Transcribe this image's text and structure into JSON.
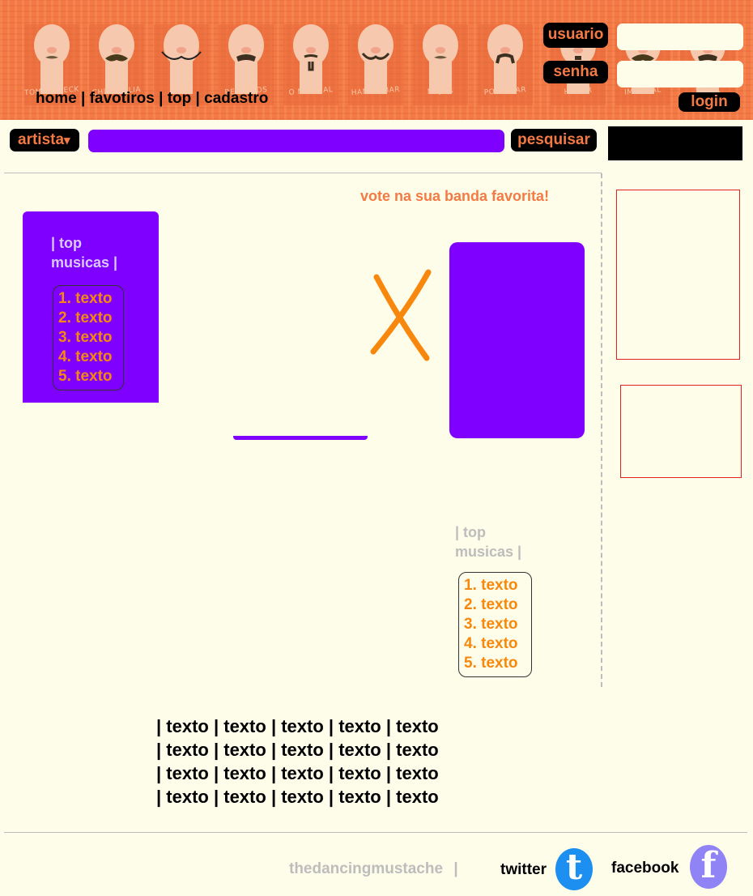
{
  "header": {
    "faces": [
      {
        "label": "TOM SELLECK",
        "mustache": "small"
      },
      {
        "label": "CHINCAGLIA",
        "mustache": "bushy"
      },
      {
        "label": "DALI",
        "mustache": "curled"
      },
      {
        "label": "REYNOLDS",
        "mustache": "walrus"
      },
      {
        "label": "O MICHEAL",
        "mustache": "goatee"
      },
      {
        "label": "HANDLEBAR",
        "mustache": "handlebar"
      },
      {
        "label": "MAJOR",
        "mustache": "small"
      },
      {
        "label": "PORNSTAR",
        "mustache": "horseshoe"
      },
      {
        "label": "HITLER",
        "mustache": "toothbrush"
      },
      {
        "label": "IMPERIAL",
        "mustache": "bushy"
      },
      {
        "label": "ZAPPA",
        "mustache": "walrus"
      }
    ],
    "nav": {
      "home": "home",
      "separator": "|",
      "favoritos": "favotiros",
      "top": "top",
      "cadastro": "cadastro"
    },
    "login": {
      "usuario_label": "usuario",
      "senha_label": "senha",
      "login_button": "login"
    }
  },
  "search": {
    "category_label": "artista",
    "category_arrow": "▾",
    "button_label": "pesquisar"
  },
  "main": {
    "vote_heading": "vote na sua banda favorita!",
    "versus_symbol": "X",
    "top_left": {
      "title_line1": "| top",
      "title_line2": "musicas |",
      "items": [
        "1. texto",
        "2. texto",
        "3. texto",
        "4. texto",
        "5. texto"
      ]
    },
    "top_right": {
      "title_line1": "| top",
      "title_line2": "musicas |",
      "items": [
        "1. texto",
        "2. texto",
        "3. texto",
        "4. texto",
        "5. texto"
      ]
    }
  },
  "footer": {
    "link_rows": [
      [
        "texto",
        "texto",
        "texto",
        "texto",
        "texto"
      ],
      [
        "texto",
        "texto",
        "texto",
        "texto",
        "texto"
      ],
      [
        "texto",
        "texto",
        "texto",
        "texto",
        "texto"
      ],
      [
        "texto",
        "texto",
        "texto",
        "texto",
        "texto"
      ]
    ],
    "brand": "thedancingmustache",
    "brand_separator": "|",
    "twitter_label": "twitter",
    "twitter_glyph": "t",
    "facebook_label": "facebook",
    "facebook_glyph": "f"
  },
  "colors": {
    "header_orange": "#f47a45",
    "purple": "#7f00ff",
    "background": "#fefde9",
    "list_orange": "#f7880d",
    "gray": "#bdbdbd",
    "twitter_blue": "#1d8ff0",
    "facebook_purple": "#8f83f5"
  }
}
